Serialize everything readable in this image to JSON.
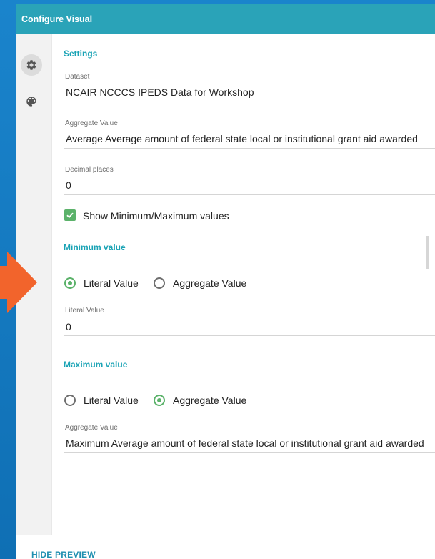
{
  "window": {
    "title": "Configure Visual"
  },
  "rail": {
    "icons": [
      "gear-icon",
      "palette-icon"
    ]
  },
  "settings": {
    "section_title": "Settings",
    "dataset": {
      "label": "Dataset",
      "value": "NCAIR NCCCS IPEDS Data for Workshop"
    },
    "aggregate": {
      "label": "Aggregate Value",
      "value": "Average Average amount of federal state local or institutional grant aid awarded"
    },
    "decimals": {
      "label": "Decimal places",
      "value": "0"
    },
    "show_minmax": {
      "label": "Show Minimum/Maximum values",
      "checked": true
    }
  },
  "minimum": {
    "title": "Minimum value",
    "option_literal": "Literal Value",
    "option_aggregate": "Aggregate Value",
    "selected": "literal",
    "field_label": "Literal Value",
    "field_value": "0"
  },
  "maximum": {
    "title": "Maximum value",
    "option_literal": "Literal Value",
    "option_aggregate": "Aggregate Value",
    "selected": "aggregate",
    "field_label": "Aggregate Value",
    "field_value": "Maximum Average amount of federal state local or institutional grant aid awarded"
  },
  "footer": {
    "hide_preview": "HIDE PREVIEW"
  },
  "colors": {
    "accent": "#2aa3b8",
    "check": "#5bb26a",
    "arrow": "#f2642c",
    "background": "#1479c2"
  }
}
